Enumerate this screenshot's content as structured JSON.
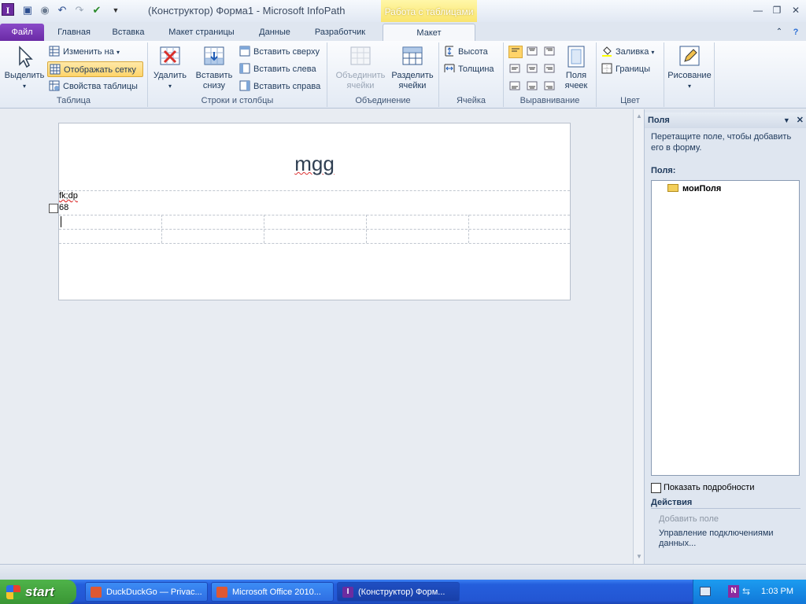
{
  "window": {
    "title": "(Конструктор) Форма1 - Microsoft InfoPath",
    "context_group": "Работа с таблицами"
  },
  "tabs": [
    {
      "label": "Файл"
    },
    {
      "label": "Главная"
    },
    {
      "label": "Вставка"
    },
    {
      "label": "Макет страницы"
    },
    {
      "label": "Данные"
    },
    {
      "label": "Разработчик"
    },
    {
      "label": "Макет"
    }
  ],
  "ribbon": {
    "table": {
      "group_label": "Таблица",
      "select_label": "Выделить",
      "change_to_label": "Изменить на",
      "show_grid_label": "Отображать сетку",
      "props_label": "Свойства таблицы"
    },
    "rows_cols": {
      "group_label": "Строки и столбцы",
      "delete_label": "Удалить",
      "insert_below_label": "Вставить снизу",
      "insert_above_label": "Вставить сверху",
      "insert_left_label": "Вставить слева",
      "insert_right_label": "Вставить справа"
    },
    "merge": {
      "group_label": "Объединение",
      "merge_label": "Объединить ячейки",
      "split_label": "Разделить ячейки"
    },
    "cell": {
      "group_label": "Ячейка",
      "height_label": "Высота",
      "width_label": "Толщина"
    },
    "align": {
      "group_label": "Выравнивание",
      "padding_label": "Поля ячеек"
    },
    "color": {
      "group_label": "Цвет",
      "fill_label": "Заливка",
      "borders_label": "Границы"
    },
    "drawing": {
      "drawing_label": "Рисование"
    }
  },
  "form": {
    "title": "mgg",
    "field_label": "fk;dp",
    "field_value": "68"
  },
  "task_pane": {
    "title": "Поля",
    "hint": "Перетащите поле, чтобы добавить его в форму.",
    "fields_label": "Поля:",
    "root_item": "моиПоля",
    "show_details_label": "Показать подробности",
    "actions_label": "Действия",
    "add_field_label": "Добавить поле",
    "manage_connections_label": "Управление подключениями данных..."
  },
  "taskbar": {
    "start_label": "start",
    "tasks": [
      {
        "label": "DuckDuckGo — Privac..."
      },
      {
        "label": "Microsoft Office 2010..."
      },
      {
        "label": "(Конструктор) Форм..."
      }
    ],
    "clock": "1:03 PM"
  },
  "colors": {
    "file_tab": "#6a2aa5",
    "context_header": "#f9e46d",
    "taskbar": "#245edc",
    "start_button": "#3a9634"
  }
}
